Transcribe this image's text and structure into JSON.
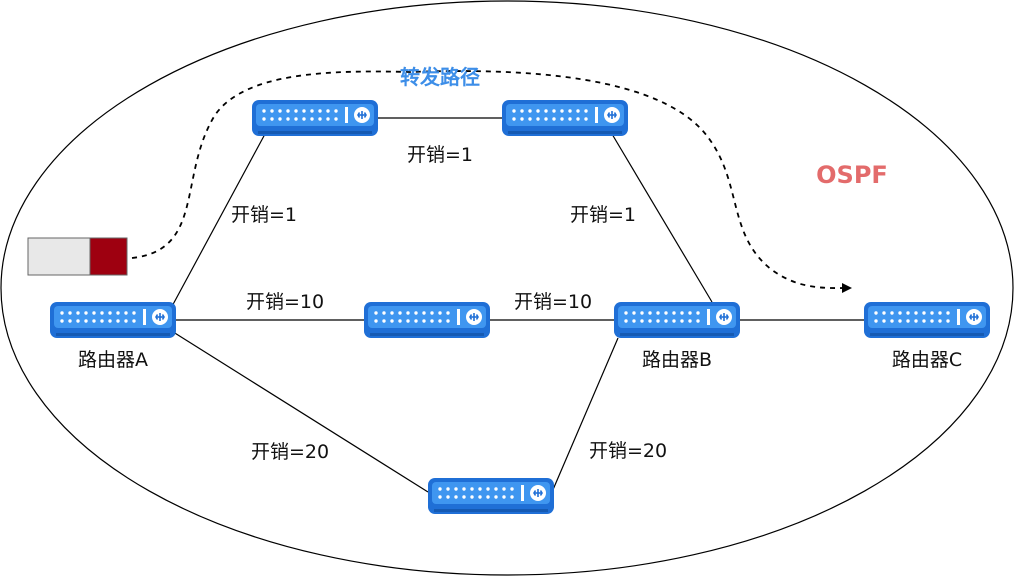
{
  "labels": {
    "forward_path": "转发路径",
    "protocol": "OSPF"
  },
  "colors": {
    "forward_path": "#3d8ee8",
    "protocol": "#e36b6b",
    "router_body": "#1f6fd6",
    "router_panel": "#3f96f0",
    "packet_light": "#e8e8e8",
    "packet_dark": "#9e0010"
  },
  "routers": {
    "a": {
      "label": "路由器A"
    },
    "b": {
      "label": "路由器B"
    },
    "c": {
      "label": "路由器C"
    }
  },
  "costs": {
    "top_mid": "开销=1",
    "top_left": "开销=1",
    "top_right": "开销=1",
    "mid_left": "开销=10",
    "mid_right": "开销=10",
    "bottom_left": "开销=20",
    "bottom_right": "开销=20"
  }
}
